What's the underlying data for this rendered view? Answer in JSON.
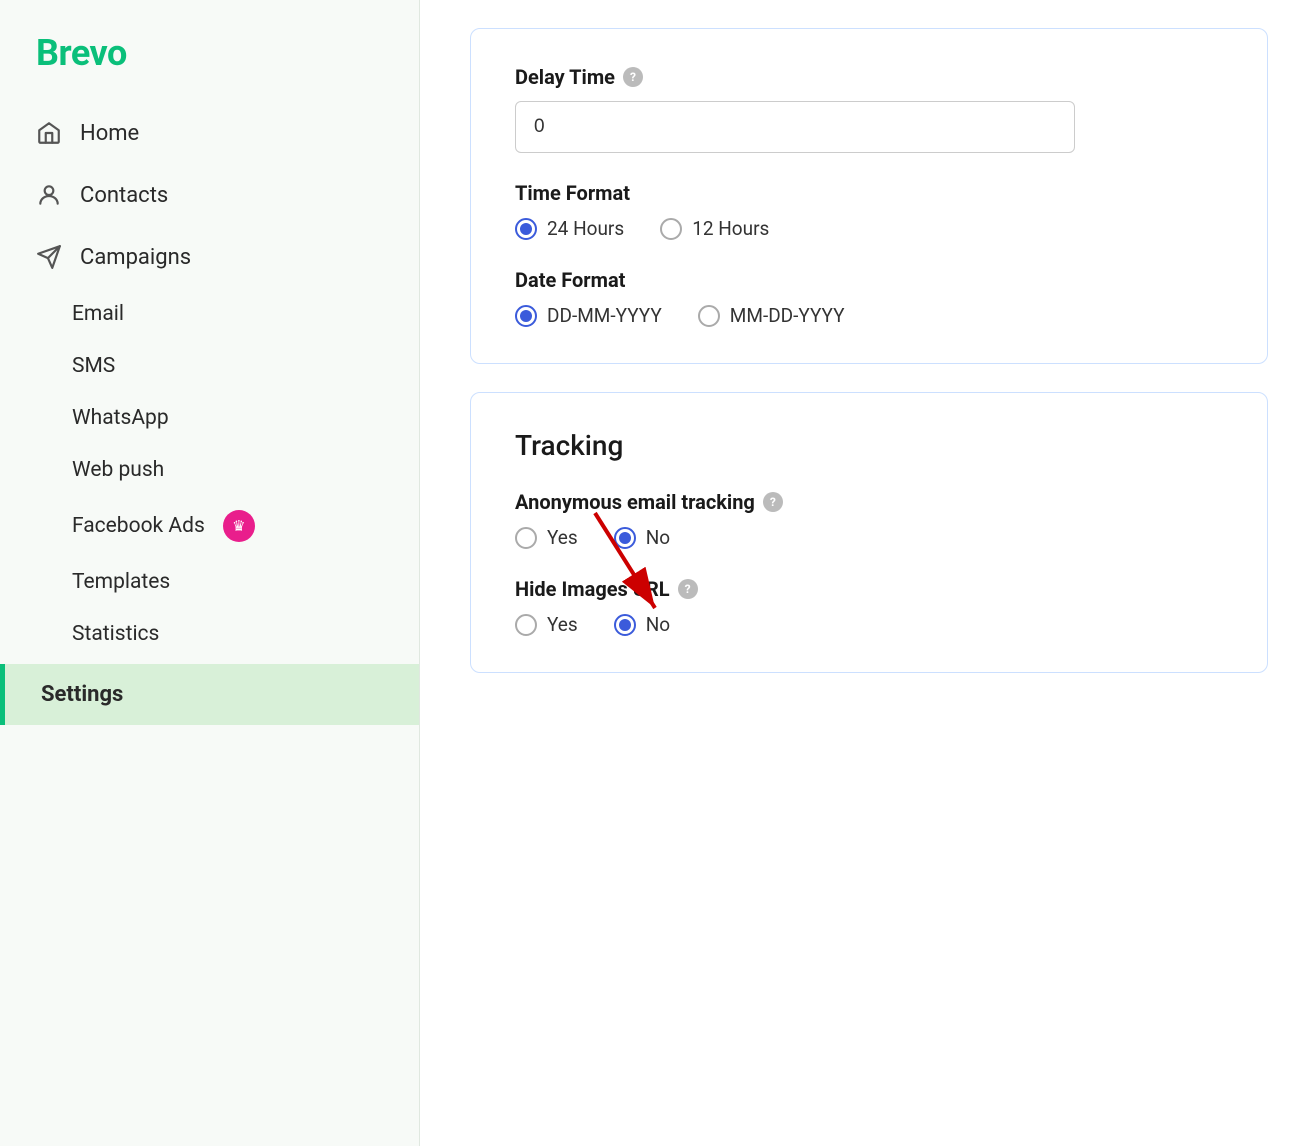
{
  "brand": {
    "name": "Brevo"
  },
  "sidebar": {
    "nav_items": [
      {
        "id": "home",
        "label": "Home",
        "icon": "home"
      },
      {
        "id": "contacts",
        "label": "Contacts",
        "icon": "contacts"
      },
      {
        "id": "campaigns",
        "label": "Campaigns",
        "icon": "campaigns"
      }
    ],
    "sub_items": [
      {
        "id": "email",
        "label": "Email",
        "badge": null
      },
      {
        "id": "sms",
        "label": "SMS",
        "badge": null
      },
      {
        "id": "whatsapp",
        "label": "WhatsApp",
        "badge": null
      },
      {
        "id": "web-push",
        "label": "Web push",
        "badge": null
      },
      {
        "id": "facebook-ads",
        "label": "Facebook Ads",
        "badge": "crown"
      },
      {
        "id": "templates",
        "label": "Templates",
        "badge": null
      },
      {
        "id": "statistics",
        "label": "Statistics",
        "badge": null
      }
    ],
    "active_item": {
      "label": "Settings"
    }
  },
  "main": {
    "sections": [
      {
        "id": "time-date-section",
        "fields": [
          {
            "id": "delay-time",
            "label": "Delay Time",
            "has_help": true,
            "type": "input",
            "value": "0"
          },
          {
            "id": "time-format",
            "label": "Time Format",
            "has_help": false,
            "type": "radio",
            "options": [
              {
                "value": "24h",
                "label": "24 Hours",
                "selected": true
              },
              {
                "value": "12h",
                "label": "12 Hours",
                "selected": false
              }
            ]
          },
          {
            "id": "date-format",
            "label": "Date Format",
            "has_help": false,
            "type": "radio",
            "options": [
              {
                "value": "dd-mm-yyyy",
                "label": "DD-MM-YYYY",
                "selected": true
              },
              {
                "value": "mm-dd-yyyy",
                "label": "MM-DD-YYYY",
                "selected": false
              }
            ]
          }
        ]
      },
      {
        "id": "tracking-section",
        "title": "Tracking",
        "fields": [
          {
            "id": "anonymous-email-tracking",
            "label": "Anonymous email tracking",
            "has_help": true,
            "type": "radio",
            "options": [
              {
                "value": "yes",
                "label": "Yes",
                "selected": false
              },
              {
                "value": "no",
                "label": "No",
                "selected": true
              }
            ]
          },
          {
            "id": "hide-images-url",
            "label": "Hide Images URL",
            "has_help": true,
            "type": "radio",
            "options": [
              {
                "value": "yes",
                "label": "Yes",
                "selected": false
              },
              {
                "value": "no",
                "label": "No",
                "selected": true
              }
            ],
            "has_arrow": true
          }
        ]
      }
    ]
  }
}
